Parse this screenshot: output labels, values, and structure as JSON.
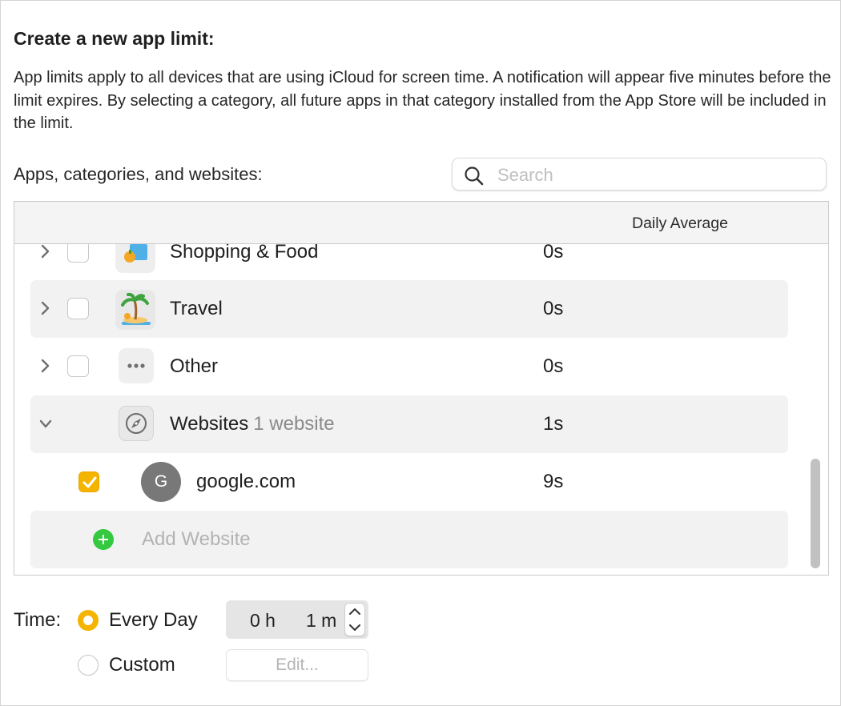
{
  "heading": "Create a new app limit:",
  "description": "App limits apply to all devices that are using iCloud for screen time. A notification will appear five minutes before the limit expires. By selecting a category, all future apps in that category installed from the App Store will be included in the limit.",
  "section_label": "Apps, categories, and websites:",
  "search": {
    "placeholder": "Search",
    "value": ""
  },
  "table": {
    "columns": {
      "daily_average": "Daily Average"
    },
    "rows": [
      {
        "label": "Shopping & Food",
        "time": "0s",
        "checked": false,
        "icon": "shopping-bag-icon"
      },
      {
        "label": "Travel",
        "time": "0s",
        "checked": false,
        "icon": "palm-tree-icon"
      },
      {
        "label": "Other",
        "time": "0s",
        "checked": false,
        "icon": "more-icon"
      },
      {
        "label": "Websites",
        "sublabel": "1 website",
        "time": "1s",
        "expanded": true,
        "icon": "compass-icon"
      }
    ],
    "websites": [
      {
        "avatar_letter": "G",
        "domain": "google.com",
        "time": "9s",
        "checked": true
      }
    ],
    "add_website": "Add Website"
  },
  "time": {
    "label": "Time:",
    "options": [
      {
        "label": "Every Day",
        "selected": true
      },
      {
        "label": "Custom",
        "selected": false
      }
    ],
    "hours": "0 h",
    "minutes": "1 m",
    "edit_label": "Edit..."
  },
  "colors": {
    "accent": "#f4b400",
    "add": "#34c940",
    "avatar": "#787878"
  }
}
